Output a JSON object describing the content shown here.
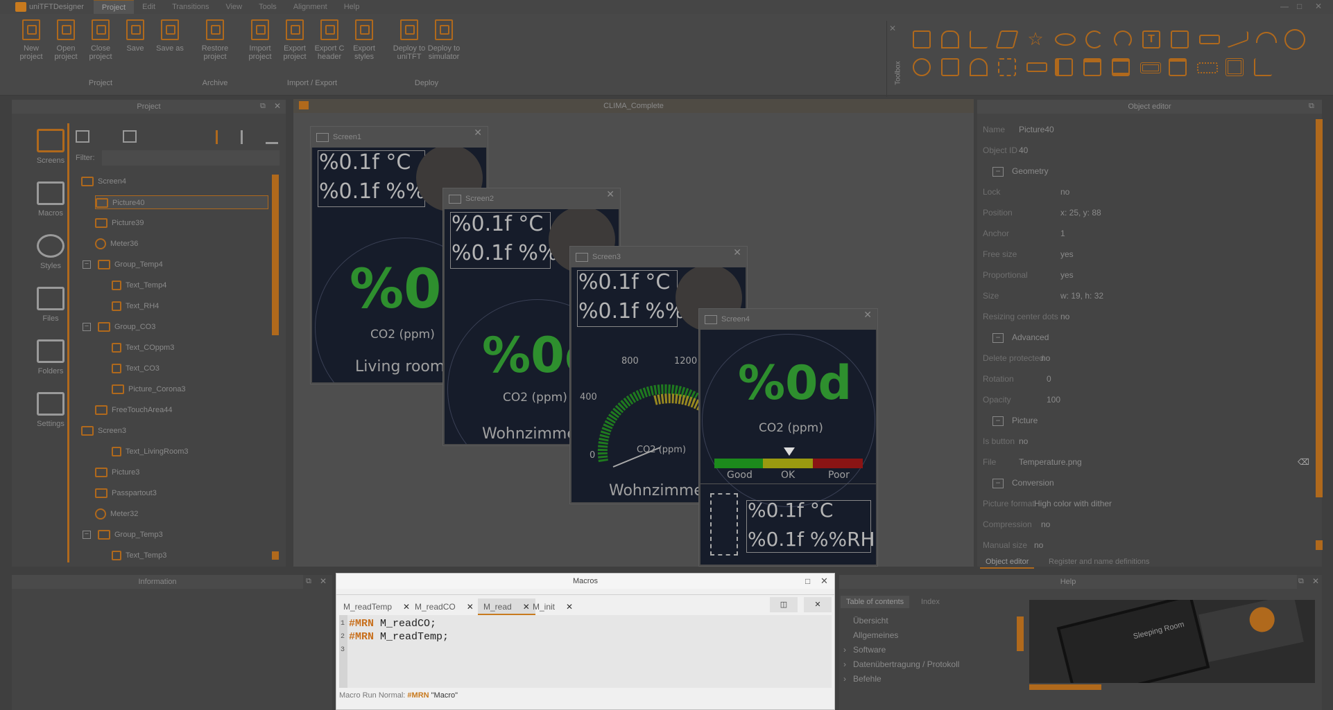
{
  "app": {
    "title": "uniTFTDesigner"
  },
  "menu": [
    "Project",
    "Edit",
    "Transitions",
    "View",
    "Tools",
    "Alignment",
    "Help"
  ],
  "ribbon": {
    "buttons": [
      {
        "id": "new-project",
        "l1": "New",
        "l2": "project"
      },
      {
        "id": "open-project",
        "l1": "Open",
        "l2": "project"
      },
      {
        "id": "close-project",
        "l1": "Close",
        "l2": "project"
      },
      {
        "id": "save",
        "l1": "Save",
        "l2": ""
      },
      {
        "id": "save-as",
        "l1": "Save as",
        "l2": ""
      },
      {
        "id": "restore-project",
        "l1": "Restore",
        "l2": "project"
      },
      {
        "id": "import-project",
        "l1": "Import",
        "l2": "project"
      },
      {
        "id": "export-project",
        "l1": "Export",
        "l2": "project"
      },
      {
        "id": "export-c-header",
        "l1": "Export C",
        "l2": "header"
      },
      {
        "id": "export-styles",
        "l1": "Export",
        "l2": "styles"
      },
      {
        "id": "deploy-unitft",
        "l1": "Deploy to",
        "l2": "uniTFT"
      },
      {
        "id": "deploy-simulator",
        "l1": "Deploy to",
        "l2": "simulator"
      }
    ],
    "groups": [
      "Project",
      "Archive",
      "Import / Export",
      "Deploy"
    ],
    "toolbox_label": "Toolbox"
  },
  "project_panel": {
    "title": "Project",
    "filter_label": "Filter:",
    "sidebar": [
      "Screens",
      "Macros",
      "Styles",
      "Files",
      "Folders",
      "Settings"
    ],
    "tree": [
      {
        "label": "Screen4",
        "kind": "screen",
        "exp": "−"
      },
      {
        "label": "Picture40",
        "kind": "picture",
        "selected": true
      },
      {
        "label": "Picture39",
        "kind": "picture"
      },
      {
        "label": "Meter36",
        "kind": "meter"
      },
      {
        "label": "Group_Temp4",
        "kind": "group",
        "exp": "−"
      },
      {
        "label": "Text_Temp4",
        "kind": "text"
      },
      {
        "label": "Text_RH4",
        "kind": "text"
      },
      {
        "label": "Group_CO3",
        "kind": "group",
        "exp": "−"
      },
      {
        "label": "Text_COppm3",
        "kind": "text"
      },
      {
        "label": "Text_CO3",
        "kind": "text"
      },
      {
        "label": "Picture_Corona3",
        "kind": "picture"
      },
      {
        "label": "FreeTouchArea44",
        "kind": "touch"
      },
      {
        "label": "Screen3",
        "kind": "screen",
        "exp": "−"
      },
      {
        "label": "Text_LivingRoom3",
        "kind": "text"
      },
      {
        "label": "Picture3",
        "kind": "picture"
      },
      {
        "label": "Passpartout3",
        "kind": "picture"
      },
      {
        "label": "Meter32",
        "kind": "meter"
      },
      {
        "label": "Group_Temp3",
        "kind": "group",
        "exp": "−"
      },
      {
        "label": "Text_Temp3",
        "kind": "text"
      }
    ]
  },
  "canvas": {
    "title": "CLIMA_Complete",
    "screens": [
      {
        "name": "Screen1",
        "temp": "%0.1f °C",
        "rh": "%0.1f %%RH",
        "value": "%0d",
        "unit": "CO2 (ppm)",
        "room": "Living room"
      },
      {
        "name": "Screen2",
        "temp": "%0.1f °C",
        "rh": "%0.1f %%RH",
        "value": "%0d",
        "unit": "CO2 (ppm)",
        "room": "Wohnzimmer"
      },
      {
        "name": "Screen3",
        "temp": "%0.1f °C",
        "rh": "%0.1f %%RH",
        "gauge_labels": [
          "0",
          "400",
          "800",
          "1200"
        ],
        "unit": "CO2 (ppm)",
        "room": "Wohnzimmer"
      },
      {
        "name": "Screen4",
        "value": "%0d",
        "unit": "CO2 (ppm)",
        "scale": [
          "Good",
          "OK",
          "Poor"
        ],
        "temp": "%0.1f °C",
        "rh": "%0.1f %%RH"
      }
    ]
  },
  "object_editor": {
    "title": "Object editor",
    "name_label": "Name",
    "name": "Picture40",
    "id_label": "Object ID",
    "id": "40",
    "sections": [
      {
        "title": "Geometry",
        "rows": [
          [
            "Lock",
            "no"
          ],
          [
            "Position",
            "x: 25,  y: 88"
          ],
          [
            "Anchor",
            "1"
          ],
          [
            "Free size",
            "yes"
          ],
          [
            "Proportional",
            "yes"
          ],
          [
            "Size",
            "w: 19,  h: 32"
          ],
          [
            "Resizing center dots",
            "no"
          ]
        ]
      },
      {
        "title": "Advanced",
        "rows": [
          [
            "Delete protected",
            "no"
          ],
          [
            "Rotation",
            "0"
          ],
          [
            "Opacity",
            "100"
          ]
        ]
      },
      {
        "title": "Picture",
        "rows": [
          [
            "Is button",
            "no"
          ],
          [
            "File",
            "Temperature.png"
          ]
        ]
      },
      {
        "title": "Conversion",
        "rows": [
          [
            "Picture format",
            "High color with dither"
          ],
          [
            "Compression",
            "no"
          ],
          [
            "Manual size",
            "no"
          ]
        ]
      }
    ],
    "tabs": [
      "Object editor",
      "Register and name definitions"
    ]
  },
  "information": {
    "title": "Information"
  },
  "macros": {
    "title": "Macros",
    "tabs": [
      "M_readTemp",
      "M_readCO",
      "M_read",
      "M_init"
    ],
    "active_tab": "M_read",
    "lines": [
      {
        "n": "1",
        "kw": "#MRN",
        "rest": " M_readCO;"
      },
      {
        "n": "2",
        "kw": "#MRN",
        "rest": " M_readTemp;"
      },
      {
        "n": "3",
        "kw": "",
        "rest": ""
      }
    ],
    "status_label": "Macro Run Normal:",
    "status_kw": "#MRN",
    "status_rest": " \"Macro\""
  },
  "help": {
    "title": "Help",
    "tabs": [
      "Table of contents",
      "Index"
    ],
    "items": [
      {
        "label": "Übersicht",
        "arrow": ""
      },
      {
        "label": "Allgemeines",
        "arrow": ""
      },
      {
        "label": "Software",
        "arrow": "›"
      },
      {
        "label": "Datenübertragung / Protokoll",
        "arrow": "›"
      },
      {
        "label": "Befehle",
        "arrow": "›"
      }
    ],
    "device_label": "Sleeping Room"
  }
}
